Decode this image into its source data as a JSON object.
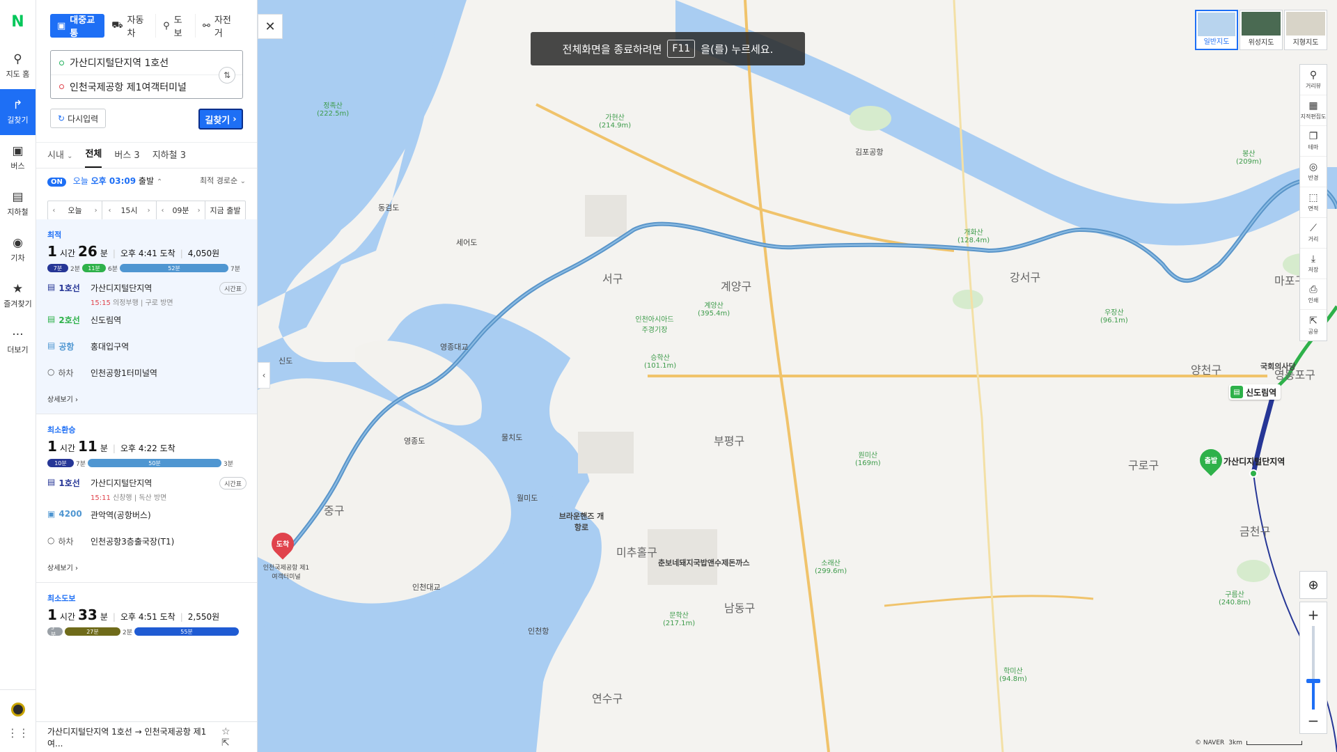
{
  "rail": {
    "logo": "N",
    "items": [
      {
        "label": "지도 홈",
        "icon": "map-pin-icon"
      },
      {
        "label": "길찾기",
        "icon": "directions-icon"
      },
      {
        "label": "버스",
        "icon": "bus-icon"
      },
      {
        "label": "지하철",
        "icon": "subway-icon"
      },
      {
        "label": "기차",
        "icon": "train-icon"
      },
      {
        "label": "즐겨찾기",
        "icon": "star-icon"
      },
      {
        "label": "더보기",
        "icon": "more-icon"
      }
    ]
  },
  "modes": [
    {
      "label": "대중교통",
      "active": true
    },
    {
      "label": "자동차"
    },
    {
      "label": "도보"
    },
    {
      "label": "자전거"
    }
  ],
  "origin": "가산디지털단지역 1호선",
  "destination": "인천국제공항 제1여객터미널",
  "reset_label": "다시입력",
  "search_label": "길찾기",
  "tabs": {
    "filter": "시내",
    "all": "전체",
    "bus": "버스 3",
    "subway": "지하철 3"
  },
  "depart": {
    "on": "ON",
    "today": "오늘",
    "time": "오후 03:09",
    "suffix": "출발",
    "sort": "최적 경로순"
  },
  "time_selector": {
    "day": "오늘",
    "hour": "15시",
    "minute": "09분",
    "now": "지금 출발"
  },
  "routes": [
    {
      "tag": "최적",
      "hours": "1",
      "hours_unit": "시간",
      "minutes": "26",
      "minutes_unit": "분",
      "arrival": "오후 4:41 도착",
      "fare": "4,050원",
      "bar": {
        "walk1": "2분",
        "seg1": "7분",
        "seg2": "11분",
        "walk2": "6분",
        "seg3": "52분",
        "walk3": "7분"
      },
      "steps": [
        {
          "line": "1호선",
          "station": "가산디지털단지역",
          "time": "15:15",
          "sub": "의정부행",
          "dir": "구로 방면",
          "button": "시간표"
        },
        {
          "line": "2호선",
          "station": "신도림역"
        },
        {
          "line": "공항",
          "station": "홍대입구역"
        },
        {
          "line": "하차",
          "station": "인천공항1터미널역"
        }
      ],
      "more": "상세보기"
    },
    {
      "tag": "최소환승",
      "hours": "1",
      "hours_unit": "시간",
      "minutes": "11",
      "minutes_unit": "분",
      "arrival": "오후 4:22 도착",
      "bar": {
        "seg1": "10분",
        "walk1": "7분",
        "seg2": "50분",
        "walk2": "3분"
      },
      "steps": [
        {
          "line": "1호선",
          "station": "가산디지털단지역",
          "time": "15:11",
          "sub": "신창행",
          "dir": "독산 방면",
          "button": "시간표"
        },
        {
          "line": "4200",
          "station": "관악역(공항버스)"
        },
        {
          "line": "하차",
          "station": "인천공항3층출국장(T1)"
        }
      ],
      "more": "상세보기"
    },
    {
      "tag": "최소도보",
      "hours": "1",
      "hours_unit": "시간",
      "minutes": "33",
      "minutes_unit": "분",
      "arrival": "오후 4:51 도착",
      "fare": "2,550원",
      "bar": {
        "walk1": "3분",
        "seg1": "27분",
        "walk2": "2분",
        "seg2": "55분"
      }
    }
  ],
  "bottom": {
    "summary": "가산디지털단지역 1호선 → 인천국제공항 제1여..."
  },
  "fullscreen_notice": {
    "before": "전체화면을 종료하려면",
    "key": "F11",
    "after": "을(를) 누르세요."
  },
  "map_types": [
    "일반지도",
    "위성지도",
    "지형지도"
  ],
  "map_tools": [
    "거리뷰",
    "지적편집도",
    "테마",
    "반경",
    "면적",
    "거리",
    "저장",
    "인쇄",
    "공유"
  ],
  "map_labels": {
    "districts": [
      "서구",
      "계양구",
      "부평구",
      "미추홀구",
      "남동구",
      "연수구",
      "강서구",
      "양천구",
      "구로구",
      "금천구",
      "마포구",
      "영등포구",
      "중구"
    ],
    "islands": [
      "영종도",
      "동검도",
      "세어도",
      "물치도",
      "신도",
      "월미도"
    ],
    "mountains": [
      {
        "name": "가현산",
        "height": "(214.9m)"
      },
      {
        "name": "계양산",
        "height": "(395.4m)"
      },
      {
        "name": "승학산",
        "height": "(101.1m)"
      },
      {
        "name": "원미산",
        "height": "(169m)"
      },
      {
        "name": "소래산",
        "height": "(299.6m)"
      },
      {
        "name": "문학산",
        "height": "(217.1m)"
      },
      {
        "name": "정족산",
        "height": "(222.5m)"
      },
      {
        "name": "개화산",
        "height": "(128.4m)"
      },
      {
        "name": "우장산",
        "height": "(96.1m)"
      },
      {
        "name": "구름산",
        "height": "(240.8m)"
      },
      {
        "name": "학미산",
        "height": "(94.8m)"
      },
      {
        "name": "봉산",
        "height": "(209m)"
      }
    ],
    "places": [
      "김포공항",
      "인천항",
      "브라운핸즈 개항로",
      "춘보네돼지국밥앤수제돈까스",
      "국회의사당",
      "인천아시아드주경기장",
      "인천대교",
      "영종대교"
    ],
    "stations": {
      "sindorim": "신도림역",
      "gasan": "가산디지털단지역",
      "start_pin": "출발",
      "end_pin": "도착",
      "airport": "인천국제공항 제1여객터미널"
    }
  },
  "attribution": "© NAVER",
  "scale_label": "3km",
  "colors": {
    "accent": "#1e6ff5",
    "line1": "#263696",
    "line2": "#2eb14a",
    "airport": "#4f96d1",
    "water": "#a9cdf2"
  }
}
